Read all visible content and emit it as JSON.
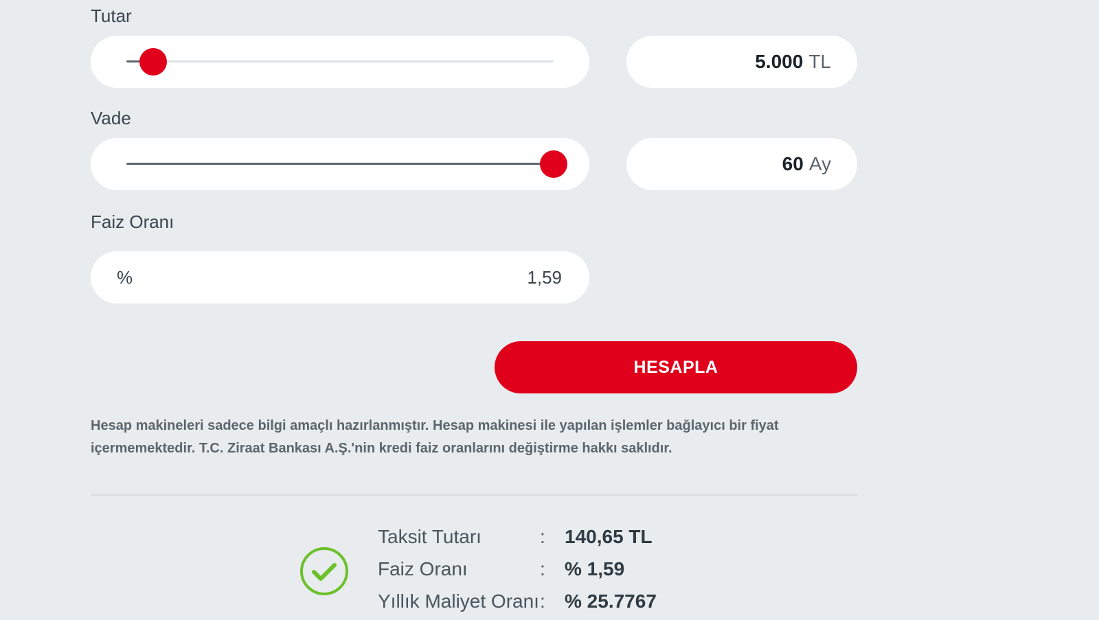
{
  "amount": {
    "label": "Tutar",
    "value": "5.000",
    "unit": "TL",
    "slider_fraction": 0.05
  },
  "term": {
    "label": "Vade",
    "value": "60",
    "unit": "Ay",
    "slider_fraction": 1.0
  },
  "interest": {
    "label": "Faiz Oranı",
    "prefix": "%",
    "value": "1,59"
  },
  "calculate_button": "HESAPLA",
  "disclaimer": "Hesap makineleri sadece bilgi amaçlı hazırlanmıştır. Hesap makinesi ile yapılan işlemler bağlayıcı bir fiyat içermemektedir. T.C. Ziraat Bankası A.Ş.'nin kredi faiz oranlarını değiştirme hakkı saklıdır.",
  "results": {
    "icon": "check-circle-icon",
    "rows": [
      {
        "label": "Taksit Tutarı",
        "colon": ":",
        "value": "140,65 TL"
      },
      {
        "label": "Faiz Oranı",
        "colon": ":",
        "value": "% 1,59"
      },
      {
        "label": "Yıllık Maliyet Oranı",
        "colon": ":",
        "value": "% 25.7767"
      }
    ]
  },
  "colors": {
    "accent": "#e0001b",
    "background": "#e8ecef",
    "success": "#6cc12a"
  }
}
